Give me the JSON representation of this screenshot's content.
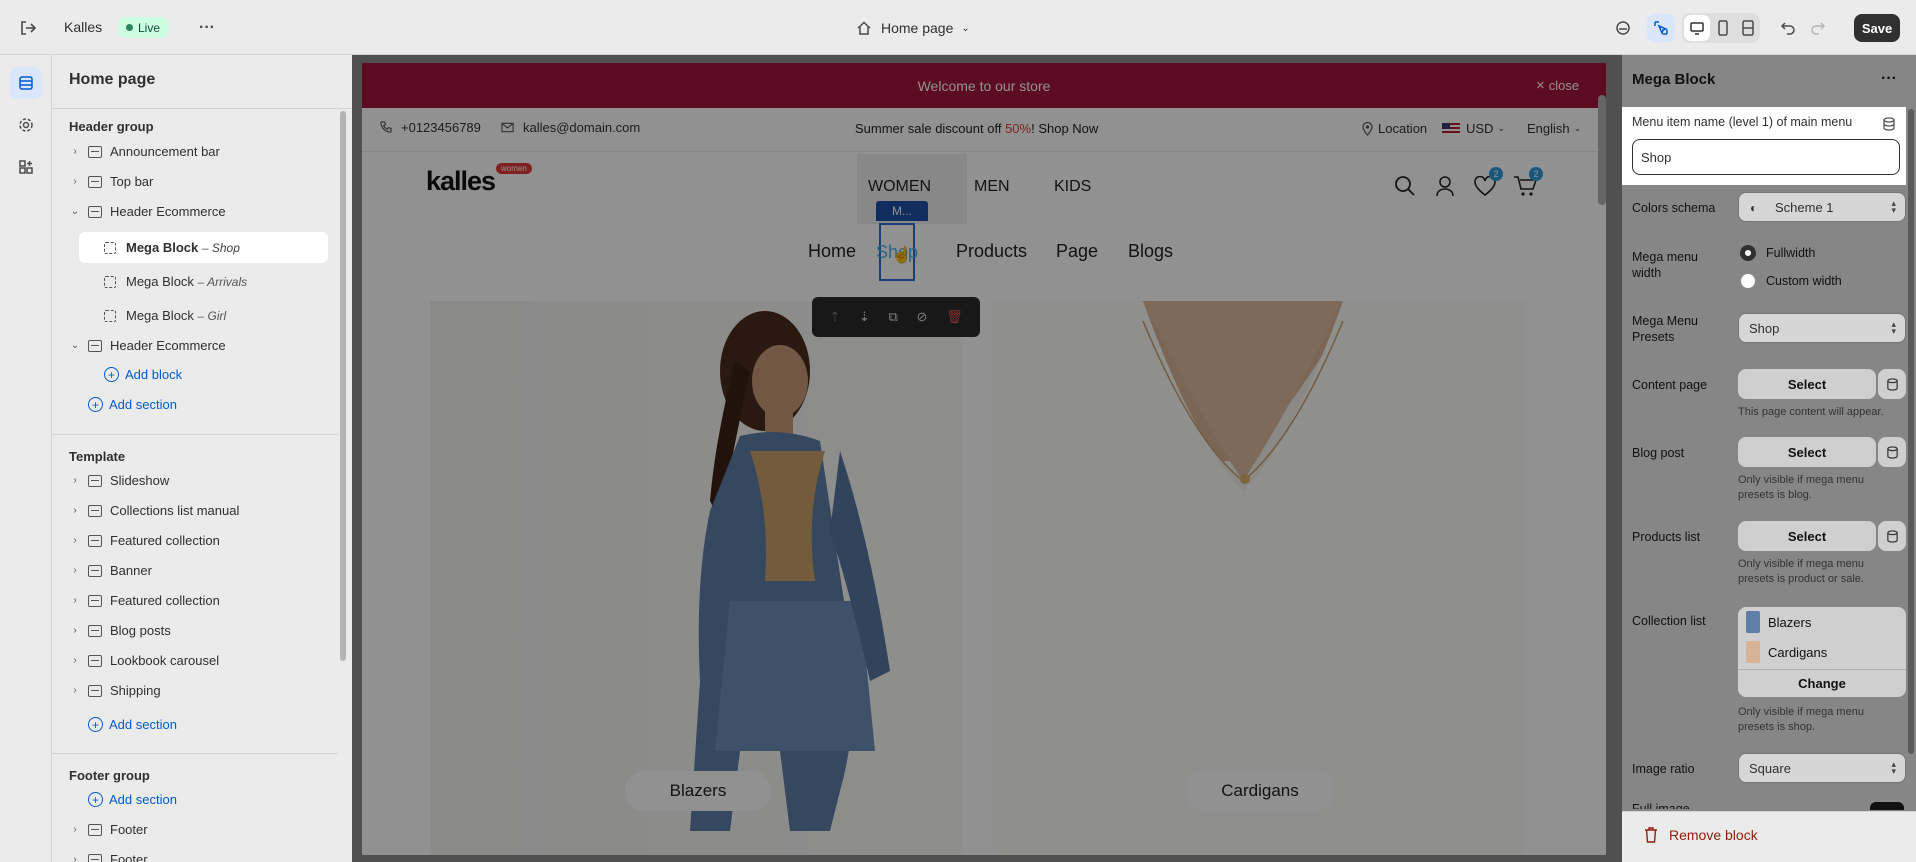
{
  "topbar": {
    "store_name": "Kalles",
    "status_badge": "Live",
    "page_selector": "Home page",
    "save_label": "Save"
  },
  "left": {
    "title": "Home page",
    "header_group": "Header group",
    "items": {
      "announcement": "Announcement bar",
      "topbar": "Top bar",
      "header_ecom": "Header Ecommerce",
      "mega1": "Mega Block",
      "mega1_sub": "– Shop",
      "mega2": "Mega Block",
      "mega2_sub": "– Arrivals",
      "mega3": "Mega Block",
      "mega3_sub": "– Girl",
      "header_ecom2": "Header Ecommerce"
    },
    "add_block": "Add block",
    "add_section": "Add section",
    "template": "Template",
    "template_items": [
      "Slideshow",
      "Collections list manual",
      "Featured collection",
      "Banner",
      "Featured collection",
      "Blog posts",
      "Lookbook carousel",
      "Shipping"
    ],
    "footer_group": "Footer group",
    "footer_items": [
      "Footer",
      "Footer"
    ]
  },
  "store": {
    "announcement": "Welcome to our store",
    "close": "close",
    "phone": "+0123456789",
    "email": "kalles@domain.com",
    "promo_prefix": "Summer sale discount off ",
    "promo_pct": "50%",
    "promo_suffix": "! Shop Now",
    "location": "Location",
    "currency": "USD",
    "language": "English",
    "logo": "kalles",
    "logo_badge": "women",
    "nav_top": [
      "WOMEN",
      "MEN",
      "KIDS"
    ],
    "wishlist_count": "2",
    "cart_count": "2",
    "block_tag": "M...",
    "nav_main": [
      "Home",
      "Shop",
      "Products",
      "Page",
      "Blogs"
    ],
    "card1": "Blazers",
    "card2": "Cardigans"
  },
  "right": {
    "title": "Mega Block",
    "menu_item_label": "Menu item name (level 1) of main menu",
    "menu_item_value": "Shop",
    "colors_label": "Colors schema",
    "colors_value": "Scheme 1",
    "width_label": "Mega menu width",
    "width_opt1": "Fullwidth",
    "width_opt2": "Custom width",
    "presets_label": "Mega Menu Presets",
    "presets_value": "Shop",
    "content_label": "Content page",
    "select": "Select",
    "content_hint": "This page content will appear.",
    "blog_label": "Blog post",
    "blog_hint": "Only visible if mega menu presets is blog.",
    "products_label": "Products list",
    "products_hint": "Only visible if mega menu presets is product or sale.",
    "collection_label": "Collection list",
    "collections": [
      "Blazers",
      "Cardigans"
    ],
    "change": "Change",
    "collection_hint": "Only visible if mega menu presets is shop.",
    "ratio_label": "Image ratio",
    "ratio_value": "Square",
    "full_image": "Full image",
    "remove": "Remove block"
  },
  "colors": {
    "accent": "#005bd3",
    "announcement_bg": "#a3143f",
    "live_green": "#29845a",
    "badge_red": "#e23a3a",
    "wish_blue": "#2c9bd6"
  }
}
